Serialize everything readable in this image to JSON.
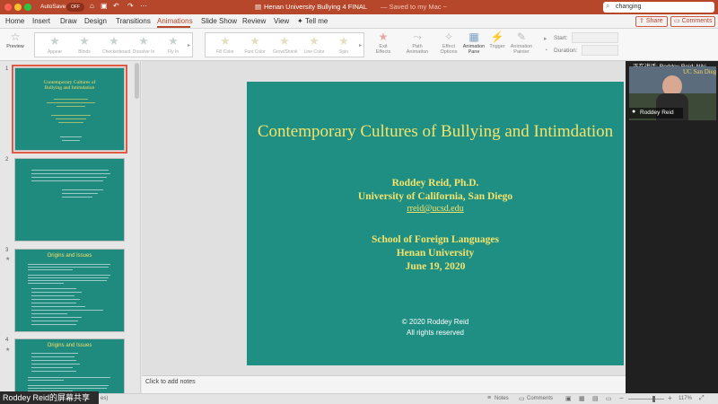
{
  "titlebar": {
    "autosave_label": "AutoSave",
    "autosave_state": "OFF",
    "document_title": "Henan University Bullying 4 FINAL",
    "save_status": "— Saved to my Mac ~",
    "search_value": "changing",
    "accent_color": "#b7472a"
  },
  "ribbon_tabs": [
    "Home",
    "Insert",
    "Draw",
    "Design",
    "Transitions",
    "Animations",
    "Slide Show",
    "Review",
    "View"
  ],
  "active_tab": "Animations",
  "tell_me": "Tell me",
  "share_label": "Share",
  "comments_label": "Comments",
  "ribbon": {
    "preview_label": "Preview",
    "entrance_effects": [
      "Appear",
      "Blinds",
      "Checkerboard",
      "Dissolve In",
      "Fly In"
    ],
    "emphasis_effects": [
      "Fill Color",
      "Font Color",
      "Grow/Shrink",
      "Line Color",
      "Spin"
    ],
    "exit_label": "Exit Effects",
    "path_label": "Path Animation",
    "options_label": "Effect Options",
    "pane_label": "Animation Pane",
    "trigger_label": "Trigger",
    "painter_label": "Animation Painter",
    "start_label": "Start:",
    "duration_label": "Duration:"
  },
  "slides": [
    {
      "number": "1",
      "title": "Contemporary Cultures of Bullying and Intimdation",
      "selected": true
    },
    {
      "number": "2",
      "title": ""
    },
    {
      "number": "3",
      "title": "Origins and Issues"
    },
    {
      "number": "4",
      "title": "Origins and Issues"
    }
  ],
  "slide": {
    "title": "Contemporary Cultures of Bullying and Intimdation",
    "author": "Roddey Reid, Ph.D.",
    "affiliation": "University of California, San Diego",
    "email": "rreid@ucsd.edu",
    "school": "School of Foreign Languages",
    "university": "Henan University",
    "date": "June 19, 2020",
    "copyright": "© 2020 Roddey Reid",
    "rights": "All rights reserved",
    "background_color": "#208f83",
    "text_color": "#f3e36c"
  },
  "notes_placeholder": "Click to add notes",
  "statusbar": {
    "notes_label": "Notes",
    "comments_label": "Comments",
    "zoom": "117%",
    "slide_info_fragment": "es)"
  },
  "video": {
    "speaking_label": "正在讲话: Roddey Reid; Niki",
    "participant_name": "Roddey Reid",
    "background_text": "UC San Diego"
  },
  "share_banner": "Roddey Reid的屏幕共享"
}
